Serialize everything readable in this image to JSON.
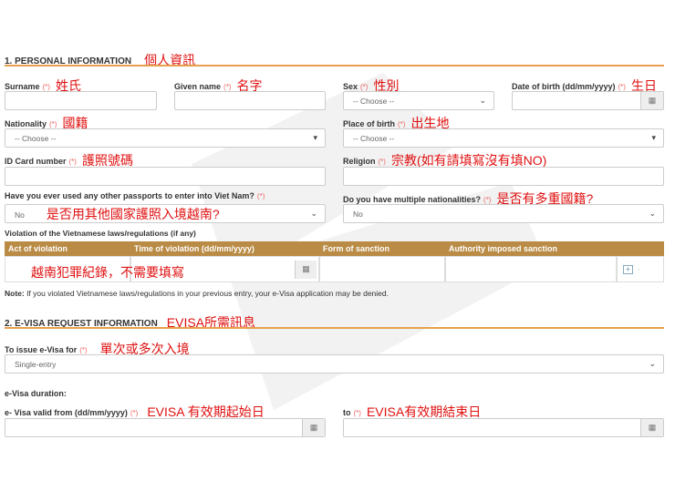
{
  "section1": {
    "title": "1. PERSONAL INFORMATION",
    "annotation": "個人資訊"
  },
  "required_mark": "(*)",
  "fields": {
    "surname": {
      "label": "Surname",
      "annotation": "姓氏"
    },
    "given_name": {
      "label": "Given name",
      "annotation": "名字"
    },
    "sex": {
      "label": "Sex",
      "annotation": "性別",
      "value": "-- Choose --"
    },
    "dob": {
      "label": "Date of birth (dd/mm/yyyy)",
      "annotation": "生日"
    },
    "nationality": {
      "label": "Nationality",
      "annotation": "國籍",
      "value": "-- Choose --"
    },
    "place_of_birth": {
      "label": "Place of birth",
      "annotation": "出生地",
      "value": "-- Choose --"
    },
    "id_card": {
      "label": "ID Card number",
      "annotation": "護照號碼"
    },
    "religion": {
      "label": "Religion",
      "annotation": "宗教(如有請填寫沒有填NO)"
    },
    "other_passports": {
      "label": "Have you ever used any other passports to enter into Viet Nam?",
      "annotation": "是否用其他國家護照入境越南?",
      "value": "No"
    },
    "multi_nationality": {
      "label": "Do you have multiple nationalities?",
      "annotation": "是否有多重國籍?",
      "value": "No"
    }
  },
  "violation": {
    "label": "Violation of the Vietnamese laws/regulations (if any)",
    "columns": [
      "Act of violation",
      "Time of violation (dd/mm/yyyy)",
      "Form of sanction",
      "Authority imposed sanction"
    ],
    "annotation": "越南犯罪紀錄，不需要填寫",
    "add": "+",
    "remove": "-"
  },
  "note": {
    "bold": "Note:",
    "text": " If you violated Vietnamese laws/regulations in your previous entry, your e-Visa application may be denied."
  },
  "section2": {
    "title": "2. E-VISA REQUEST INFORMATION",
    "annotation": "EVISA所需訊息"
  },
  "issue_for": {
    "label": "To issue e-Visa for",
    "annotation": "單次或多次入境",
    "value": "Single-entry"
  },
  "duration": {
    "label": "e-Visa duration:"
  },
  "valid_from": {
    "label": "e- Visa valid from (dd/mm/yyyy)",
    "annotation": "EVISA 有效期起始日"
  },
  "valid_to": {
    "label": "to",
    "annotation": "EVISA有效期結束日"
  },
  "icons": {
    "calendar": "▦",
    "caret": "▾",
    "chevron": "⌄"
  }
}
